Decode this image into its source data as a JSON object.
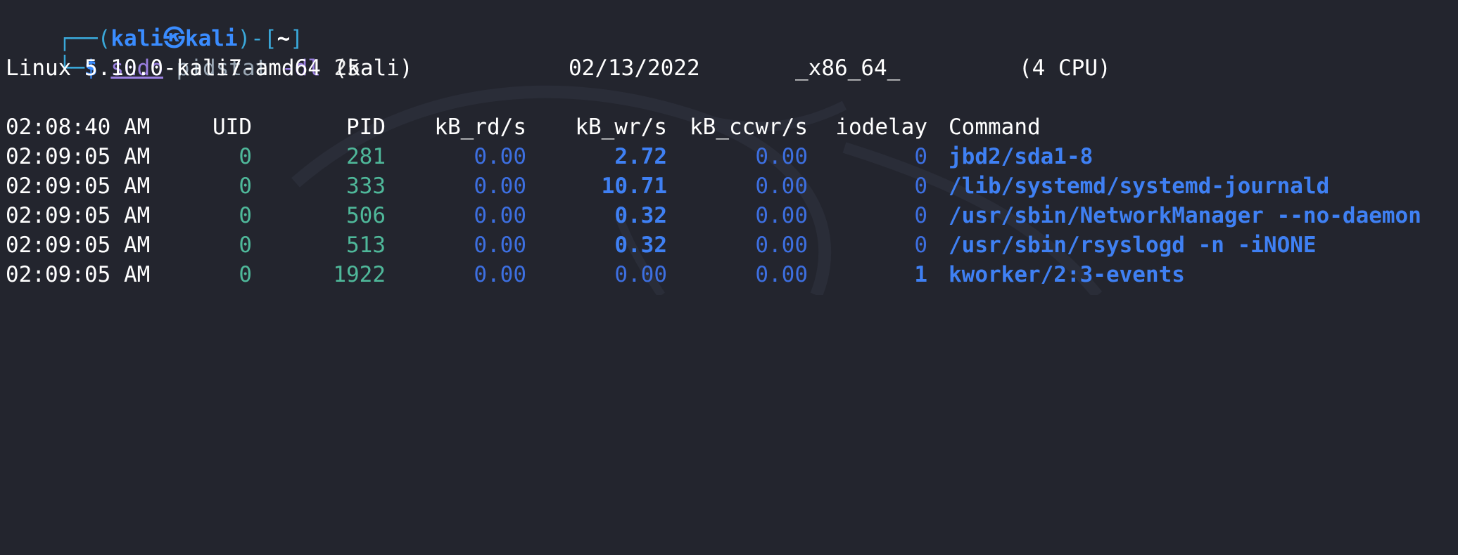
{
  "prompt": {
    "frame_top": "┌──(",
    "user": "kali",
    "at_symbol": "㉿",
    "host": "kali",
    "close_paren": ")-[",
    "dir": "~",
    "close_bracket": "]",
    "frame_bottom": "└─",
    "dollar": "$"
  },
  "command": {
    "sudo": "sudo",
    "program": "pidstat",
    "flag": "-dl",
    "interval": "25"
  },
  "sysinfo": {
    "kernel": "Linux 5.10.0-kali7-amd64 (kali)",
    "date": "02/13/2022",
    "arch": "_x86_64_",
    "cpus": "(4 CPU)"
  },
  "table": {
    "header": {
      "time": "02:08:40 AM",
      "uid": "UID",
      "pid": "PID",
      "kb_rd": "kB_rd/s",
      "kb_wr": "kB_wr/s",
      "kb_ccwr": "kB_ccwr/s",
      "iodelay": "iodelay",
      "command": "Command"
    },
    "rows": [
      {
        "time": "02:09:05 AM",
        "uid": "0",
        "pid": "281",
        "kb_rd": "0.00",
        "kb_wr": "2.72",
        "kb_ccwr": "0.00",
        "iodelay": "0",
        "command": "jbd2/sda1-8"
      },
      {
        "time": "02:09:05 AM",
        "uid": "0",
        "pid": "333",
        "kb_rd": "0.00",
        "kb_wr": "10.71",
        "kb_ccwr": "0.00",
        "iodelay": "0",
        "command": "/lib/systemd/systemd-journald"
      },
      {
        "time": "02:09:05 AM",
        "uid": "0",
        "pid": "506",
        "kb_rd": "0.00",
        "kb_wr": "0.32",
        "kb_ccwr": "0.00",
        "iodelay": "0",
        "command": "/usr/sbin/NetworkManager --no-daemon"
      },
      {
        "time": "02:09:05 AM",
        "uid": "0",
        "pid": "513",
        "kb_rd": "0.00",
        "kb_wr": "0.32",
        "kb_ccwr": "0.00",
        "iodelay": "0",
        "command": "/usr/sbin/rsyslogd -n -iNONE"
      },
      {
        "time": "02:09:05 AM",
        "uid": "0",
        "pid": "1922",
        "kb_rd": "0.00",
        "kb_wr": "0.00",
        "kb_ccwr": "0.00",
        "iodelay": "1",
        "command": "kworker/2:3-events"
      }
    ]
  },
  "colors": {
    "background": "#23252e",
    "value_zero": "#3d6fe0",
    "value_nonzero": "#3f80f3",
    "id_green": "#4fb89a"
  },
  "icons": {
    "background": "kali-dragon-logo"
  }
}
